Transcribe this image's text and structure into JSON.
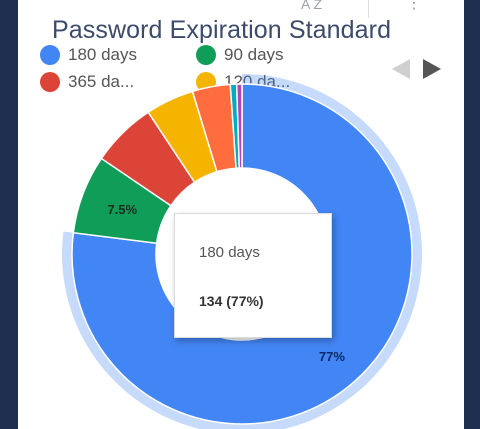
{
  "chart_data": {
    "type": "pie",
    "title": "Password Expiration Standard",
    "legend_position": "top",
    "legend": [
      {
        "label": "180 days",
        "color": "#4285f4"
      },
      {
        "label": "90 days",
        "color": "#0f9d58"
      },
      {
        "label": "365 da...",
        "color": "#db4437"
      },
      {
        "label": "120 da...",
        "color": "#f4b400"
      }
    ],
    "slices": [
      {
        "label": "180 days",
        "value": 77,
        "color": "#4285f4",
        "data_label": "77%"
      },
      {
        "label": "90 days",
        "value": 7.5,
        "color": "#0f9d58",
        "data_label": "7.5%"
      },
      {
        "label": "365 days",
        "value": 6.2,
        "color": "#db4437",
        "data_label": ""
      },
      {
        "label": "120 days",
        "value": 4.6,
        "color": "#f4b400",
        "data_label": ""
      },
      {
        "label": "",
        "value": 3.6,
        "color": "#ff6d3f",
        "data_label": ""
      },
      {
        "label": "",
        "value": 0.6,
        "color": "#00acc1",
        "data_label": ""
      },
      {
        "label": "",
        "value": 0.5,
        "color": "#ab47bc",
        "data_label": ""
      }
    ],
    "highlighted_slice": 0,
    "tooltip": {
      "label": "180 days",
      "value": "134 (77%)"
    }
  },
  "toolbar": {
    "sort_icon": "A Z",
    "more_icon": "⋮"
  }
}
